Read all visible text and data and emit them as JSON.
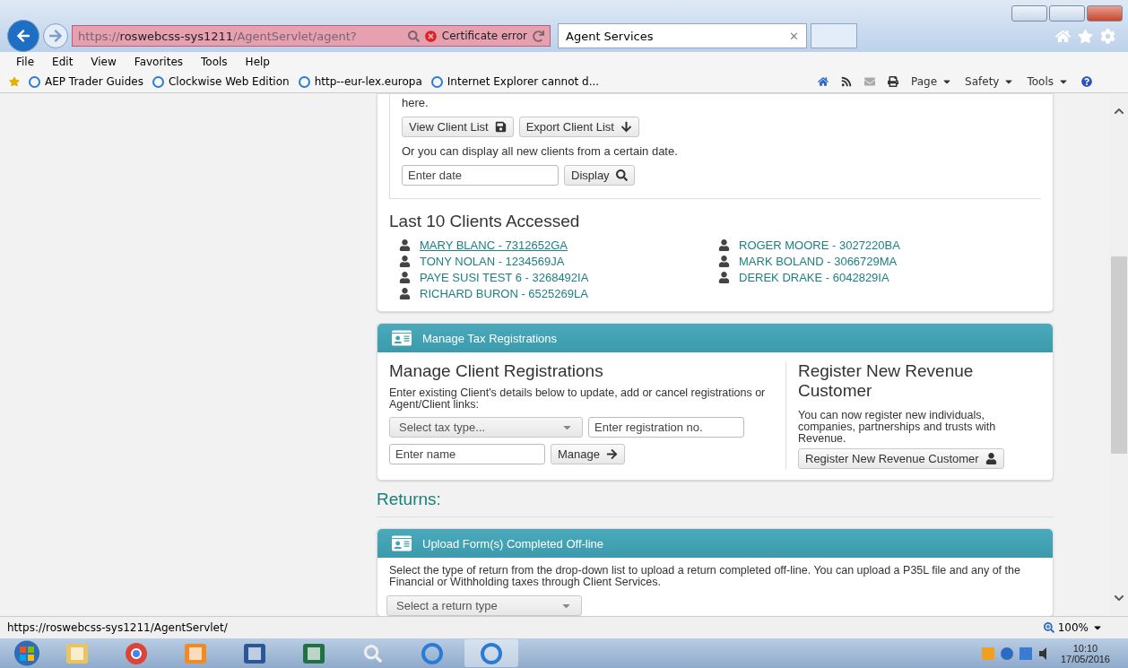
{
  "browser": {
    "address": "https://**roswebcss-sys1211**/AgentServlet/agent?",
    "certificate": "Certificate error",
    "tabs": [
      {
        "label": "Agent Services",
        "selected": true,
        "close": "✕"
      }
    ],
    "menu": [
      "File",
      "Edit",
      "View",
      "Favorites",
      "Tools",
      "Help"
    ],
    "favorites": [
      "AEP Trader Guides",
      "Clockwise Web Edition",
      "http--eur-lex.europa",
      "Internet Explorer cannot d..."
    ],
    "commands": [
      "Page",
      "Safety",
      "Tools"
    ]
  },
  "client_list": {
    "intro": "here.",
    "buttons": [
      "View Client List",
      "Export Client List"
    ],
    "date_text": "Or you can display all new clients from a certain date.",
    "date_placeholder": "Enter date",
    "display_button": "Display"
  },
  "recent_clients": {
    "title": "Last 10 Clients Accessed",
    "columns": [
      [
        {
          "label": "MARY BLANC - 7312652GA",
          "focused": true
        },
        {
          "label": "TONY NOLAN - 1234569JA",
          "focused": false
        },
        {
          "label": "PAYE SUSI TEST 6 - 3268492IA",
          "focused": false
        },
        {
          "label": "RICHARD BURON - 6525269LA",
          "focused": false
        }
      ],
      [
        {
          "label": "ROGER MOORE - 3027220BA",
          "focused": false
        },
        {
          "label": "MARK BOLAND - 3066729MA",
          "focused": false
        },
        {
          "label": "DEREK DRAKE - 6042829IA",
          "focused": false
        }
      ]
    ]
  },
  "tax_registrations": {
    "header": "Manage Tax Registrations",
    "manage": {
      "title": "Manage Client Registrations",
      "text": "Enter existing Client's details below to update, add or cancel registrations or Agent/Client links:",
      "tax_type_placeholder": "Select tax type...",
      "registration_placeholder": "Enter registration no.",
      "name_placeholder": "Enter name",
      "button": "Manage"
    },
    "register": {
      "title": "Register New Revenue Customer",
      "text": "You can now register new individuals, companies, partnerships and trusts with Revenue.",
      "button": "Register New Revenue Customer"
    }
  },
  "returns": {
    "title": "Returns:",
    "upload": {
      "header": "Upload Form(s) Completed Off-line",
      "text": "Select the type of return from the drop-down list to upload a return completed off-line. You can upload a P35L file and any of the Financial or Withholding taxes through Client Services.",
      "select": "Select a return type"
    }
  },
  "status_bar": {
    "url": "https://roswebcss-sys1211/AgentServlet/",
    "zoom": "100%"
  },
  "taskbar": {
    "time": "10:10",
    "date": "17/05/2016"
  }
}
